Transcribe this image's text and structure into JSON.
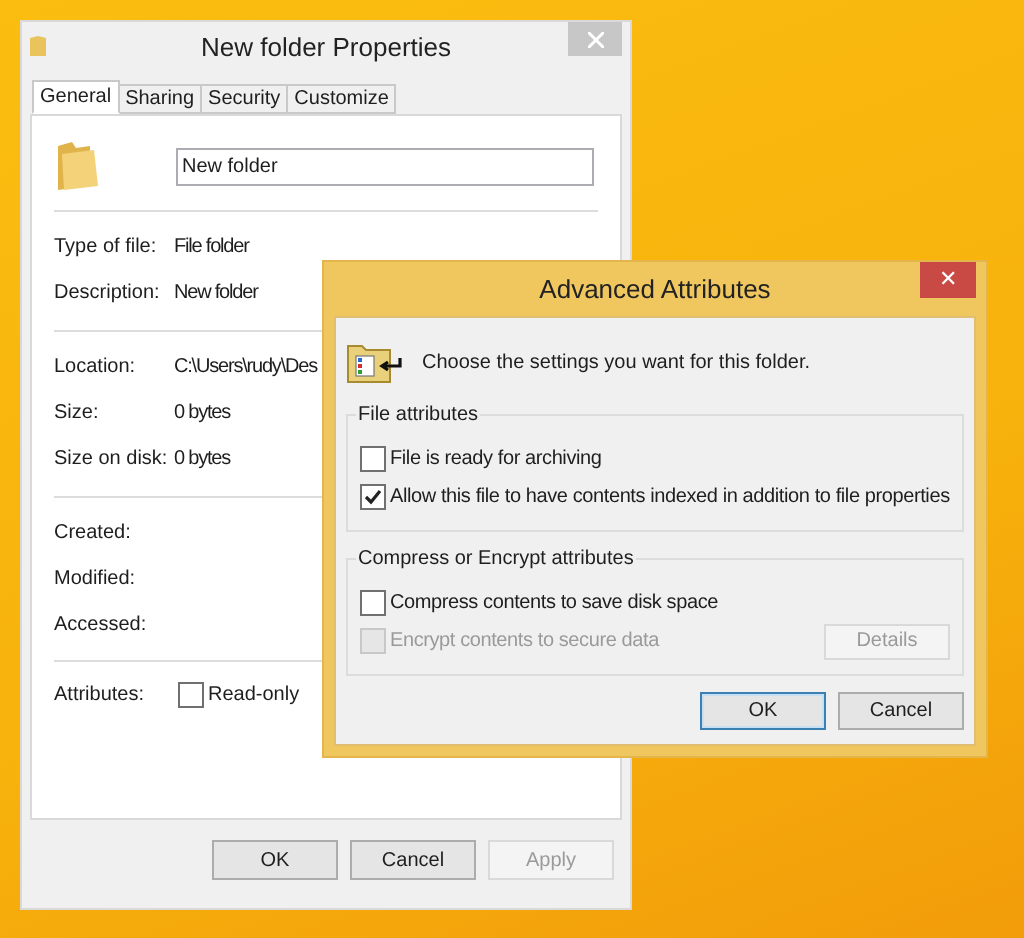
{
  "properties_window": {
    "title": "New folder Properties",
    "tabs": [
      {
        "label": "General",
        "selected": true
      },
      {
        "label": "Sharing",
        "selected": false
      },
      {
        "label": "Security",
        "selected": false
      },
      {
        "label": "Customize",
        "selected": false
      }
    ],
    "name_field": {
      "value": "New folder"
    },
    "sections": [
      [
        {
          "label": "Type of file:",
          "value": "File folder"
        },
        {
          "label": "Description:",
          "value": "New folder"
        }
      ],
      [
        {
          "label": "Location:",
          "value": "C:\\Users\\rudy\\Des"
        },
        {
          "label": "Size:",
          "value": "0 bytes"
        },
        {
          "label": "Size on disk:",
          "value": "0 bytes"
        }
      ],
      [
        {
          "label": "Created:"
        },
        {
          "label": "Modified:"
        },
        {
          "label": "Accessed:"
        }
      ]
    ],
    "attributes_label": "Attributes:",
    "attributes": [
      {
        "label": "Read-only",
        "checked": false
      }
    ],
    "buttons": [
      {
        "label": "OK",
        "disabled": false
      },
      {
        "label": "Cancel",
        "disabled": false
      },
      {
        "label": "Apply",
        "disabled": true
      }
    ]
  },
  "advanced_dialog": {
    "title": "Advanced Attributes",
    "close": "✕",
    "intro": "Choose the settings you want for this folder.",
    "groups": [
      {
        "title": "File attributes",
        "options": [
          {
            "label": "File is ready for archiving",
            "checked": false,
            "disabled": false
          },
          {
            "label": "Allow this file to have contents indexed in addition to file properties",
            "checked": true,
            "disabled": false
          }
        ]
      },
      {
        "title": "Compress or Encrypt attributes",
        "options": [
          {
            "label": "Compress contents to save disk space",
            "checked": false,
            "disabled": false
          },
          {
            "label": "Encrypt contents to secure data",
            "checked": false,
            "disabled": true
          }
        ],
        "button": {
          "label": "Details",
          "disabled": true
        }
      }
    ],
    "buttons": [
      {
        "label": "OK",
        "focused": true
      },
      {
        "label": "Cancel",
        "focused": false
      }
    ]
  }
}
